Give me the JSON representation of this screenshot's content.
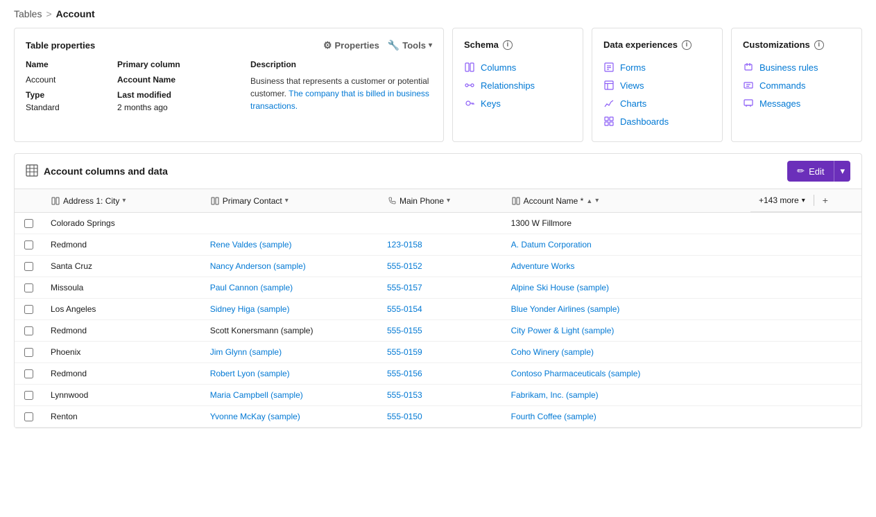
{
  "breadcrumb": {
    "parent": "Tables",
    "separator": ">",
    "current": "Account"
  },
  "table_properties": {
    "title": "Table properties",
    "toolbar": {
      "properties": "Properties",
      "tools": "Tools"
    },
    "columns": {
      "name_header": "Name",
      "primary_column_header": "Primary column",
      "description_header": "Description"
    },
    "rows": {
      "name_label": "Name",
      "name_value": "Account",
      "type_label": "Type",
      "type_value": "Standard",
      "primary_col_label": "Primary column",
      "primary_col_value": "Account Name",
      "last_modified_label": "Last modified",
      "last_modified_value": "2 months ago",
      "description_text1": "Business that represents a customer or potential customer.",
      "description_link1": "The company that is billed in business",
      "description_link2": "transactions."
    }
  },
  "schema": {
    "title": "Schema",
    "info": "i",
    "links": [
      {
        "id": "columns",
        "icon": "columns-icon",
        "label": "Columns"
      },
      {
        "id": "relationships",
        "icon": "relationships-icon",
        "label": "Relationships"
      },
      {
        "id": "keys",
        "icon": "keys-icon",
        "label": "Keys"
      }
    ]
  },
  "data_experiences": {
    "title": "Data experiences",
    "info": "i",
    "links": [
      {
        "id": "forms",
        "icon": "forms-icon",
        "label": "Forms"
      },
      {
        "id": "views",
        "icon": "views-icon",
        "label": "Views"
      },
      {
        "id": "charts",
        "icon": "charts-icon",
        "label": "Charts"
      },
      {
        "id": "dashboards",
        "icon": "dashboards-icon",
        "label": "Dashboards"
      }
    ]
  },
  "customizations": {
    "title": "Customizations",
    "info": "i",
    "links": [
      {
        "id": "business-rules",
        "icon": "business-rules-icon",
        "label": "Business rules"
      },
      {
        "id": "commands",
        "icon": "commands-icon",
        "label": "Commands"
      },
      {
        "id": "messages",
        "icon": "messages-icon",
        "label": "Messages"
      }
    ]
  },
  "account_table": {
    "title": "Account columns and data",
    "edit_label": "Edit",
    "columns": [
      {
        "id": "city",
        "icon": "city-col-icon",
        "label": "Address 1: City",
        "sortable": true
      },
      {
        "id": "primary-contact",
        "icon": "contact-col-icon",
        "label": "Primary Contact",
        "sortable": true
      },
      {
        "id": "main-phone",
        "icon": "phone-col-icon",
        "label": "Main Phone",
        "sortable": true
      },
      {
        "id": "account-name",
        "icon": "account-col-icon",
        "label": "Account Name *",
        "sortable": true
      }
    ],
    "more_cols": "+143 more",
    "rows": [
      {
        "city": "Colorado Springs",
        "contact": "",
        "phone": "",
        "account_name": "1300 W Fillmore",
        "contact_link": false
      },
      {
        "city": "Redmond",
        "contact": "Rene Valdes (sample)",
        "phone": "123-0158",
        "account_name": "A. Datum Corporation",
        "contact_link": true,
        "phone_link": true,
        "account_link": true
      },
      {
        "city": "Santa Cruz",
        "contact": "Nancy Anderson (sample)",
        "phone": "555-0152",
        "account_name": "Adventure Works",
        "contact_link": true,
        "phone_link": true,
        "account_link": true
      },
      {
        "city": "Missoula",
        "contact": "Paul Cannon (sample)",
        "phone": "555-0157",
        "account_name": "Alpine Ski House (sample)",
        "contact_link": true,
        "phone_link": true,
        "account_link": true
      },
      {
        "city": "Los Angeles",
        "contact": "Sidney Higa (sample)",
        "phone": "555-0154",
        "account_name": "Blue Yonder Airlines (sample)",
        "contact_link": true,
        "phone_link": true,
        "account_link": true
      },
      {
        "city": "Redmond",
        "contact": "Scott Konersmann (sample)",
        "phone": "555-0155",
        "account_name": "City Power & Light (sample)",
        "contact_link": false,
        "phone_link": true,
        "account_link": true
      },
      {
        "city": "Phoenix",
        "contact": "Jim Glynn (sample)",
        "phone": "555-0159",
        "account_name": "Coho Winery (sample)",
        "contact_link": true,
        "phone_link": true,
        "account_link": true
      },
      {
        "city": "Redmond",
        "contact": "Robert Lyon (sample)",
        "phone": "555-0156",
        "account_name": "Contoso Pharmaceuticals (sample)",
        "contact_link": true,
        "phone_link": true,
        "account_link": true
      },
      {
        "city": "Lynnwood",
        "contact": "Maria Campbell (sample)",
        "phone": "555-0153",
        "account_name": "Fabrikam, Inc. (sample)",
        "contact_link": true,
        "phone_link": true,
        "account_link": true
      },
      {
        "city": "Renton",
        "contact": "Yvonne McKay (sample)",
        "phone": "555-0150",
        "account_name": "Fourth Coffee (sample)",
        "contact_link": true,
        "phone_link": true,
        "account_link": true
      }
    ]
  }
}
